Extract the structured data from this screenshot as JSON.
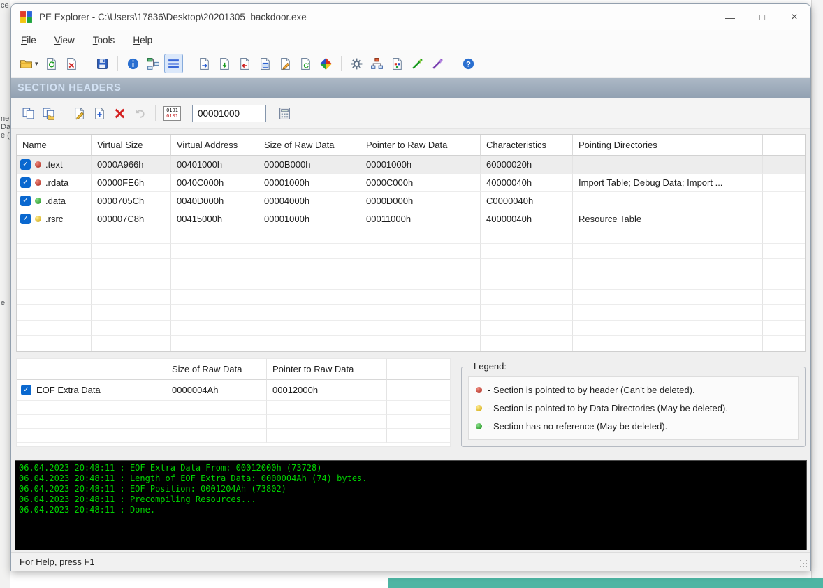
{
  "window": {
    "title": "PE Explorer - C:\\Users\\17836\\Desktop\\20201305_backdoor.exe",
    "controls": {
      "minimize": "—",
      "maximize": "□",
      "close": "×"
    }
  },
  "menu": {
    "items": [
      "File",
      "View",
      "Tools",
      "Help"
    ]
  },
  "toolbar": {
    "buttons": [
      "open-file",
      "reload-file",
      "close-file",
      "save-file",
      "headers-info",
      "data-directories",
      "section-headers",
      "export-section",
      "add-to-file",
      "remove-from-file",
      "view-file",
      "edit-resources",
      "update-file",
      "resource-viewer",
      "dependency-scanner",
      "structure-viewer",
      "resource-tools",
      "disassembler",
      "signature-scanner",
      "help"
    ],
    "active_button": "section-headers"
  },
  "banner": {
    "title": "SECTION HEADERS"
  },
  "section_toolbar": {
    "buttons": [
      "copy-section",
      "copy-special",
      "edit-section",
      "add-section",
      "delete-section",
      "undo",
      "binary-view",
      "calculator"
    ],
    "binary_top": "0101",
    "binary_bottom": "0101",
    "address_value": "00001000"
  },
  "sections_table": {
    "columns": [
      "Name",
      "Virtual Size",
      "Virtual Address",
      "Size of Raw Data",
      "Pointer to Raw Data",
      "Characteristics",
      "Pointing Directories"
    ],
    "rows": [
      {
        "checked": true,
        "dot": "red",
        "name": ".text",
        "virtual_size": "0000A966h",
        "virtual_address": "00401000h",
        "size_of_raw_data": "0000B000h",
        "pointer_to_raw_data": "00001000h",
        "characteristics": "60000020h",
        "pointing_directories": "",
        "selected": true
      },
      {
        "checked": true,
        "dot": "red",
        "name": ".rdata",
        "virtual_size": "00000FE6h",
        "virtual_address": "0040C000h",
        "size_of_raw_data": "00001000h",
        "pointer_to_raw_data": "0000C000h",
        "characteristics": "40000040h",
        "pointing_directories": "Import Table; Debug Data; Import ...",
        "selected": false
      },
      {
        "checked": true,
        "dot": "green",
        "name": ".data",
        "virtual_size": "0000705Ch",
        "virtual_address": "0040D000h",
        "size_of_raw_data": "00004000h",
        "pointer_to_raw_data": "0000D000h",
        "characteristics": "C0000040h",
        "pointing_directories": "",
        "selected": false
      },
      {
        "checked": true,
        "dot": "yellow",
        "name": ".rsrc",
        "virtual_size": "000007C8h",
        "virtual_address": "00415000h",
        "size_of_raw_data": "00001000h",
        "pointer_to_raw_data": "00011000h",
        "characteristics": "40000040h",
        "pointing_directories": "Resource Table",
        "selected": false
      }
    ]
  },
  "eof_panel": {
    "columns": [
      "Size of Raw Data",
      "Pointer to Raw Data"
    ],
    "row": {
      "checked": true,
      "label": "EOF Extra Data",
      "size_of_raw_data": "0000004Ah",
      "pointer_to_raw_data": "00012000h"
    }
  },
  "legend": {
    "title": "Legend:",
    "items": [
      {
        "dot": "red",
        "text": "- Section is pointed to by header (Can't be deleted)."
      },
      {
        "dot": "yellow",
        "text": "- Section is pointed to by Data Directories (May be deleted)."
      },
      {
        "dot": "green",
        "text": "- Section has no reference (May be deleted)."
      }
    ]
  },
  "log": {
    "lines": [
      "06.04.2023 20:48:11 : EOF Extra Data From: 00012000h  (73728)",
      "06.04.2023 20:48:11 : Length of EOF Extra Data: 0000004Ah  (74) bytes.",
      "06.04.2023 20:48:11 : EOF Position: 0001204Ah  (73802)",
      "06.04.2023 20:48:11 : Precompiling Resources...",
      "06.04.2023 20:48:11 : Done."
    ]
  },
  "status_bar": {
    "text": "For Help, press F1"
  },
  "background": {
    "fragments": [
      {
        "text": "ce"
      },
      {
        "text": "ne"
      },
      {
        "text": "Da"
      },
      {
        "text": "e ("
      },
      {
        "text": "e"
      }
    ]
  },
  "colors": {
    "dot_red": "#a51e12",
    "dot_yellow": "#caa305",
    "dot_green": "#128a12",
    "checkbox_blue": "#0a68cf",
    "banner_text": "#d3e2f4",
    "banner_bg": "#9aa8b8",
    "log_text": "#00d400",
    "log_bg": "#000000",
    "selected_row": "#ededed",
    "teal_strip": "#4eb5a3"
  }
}
